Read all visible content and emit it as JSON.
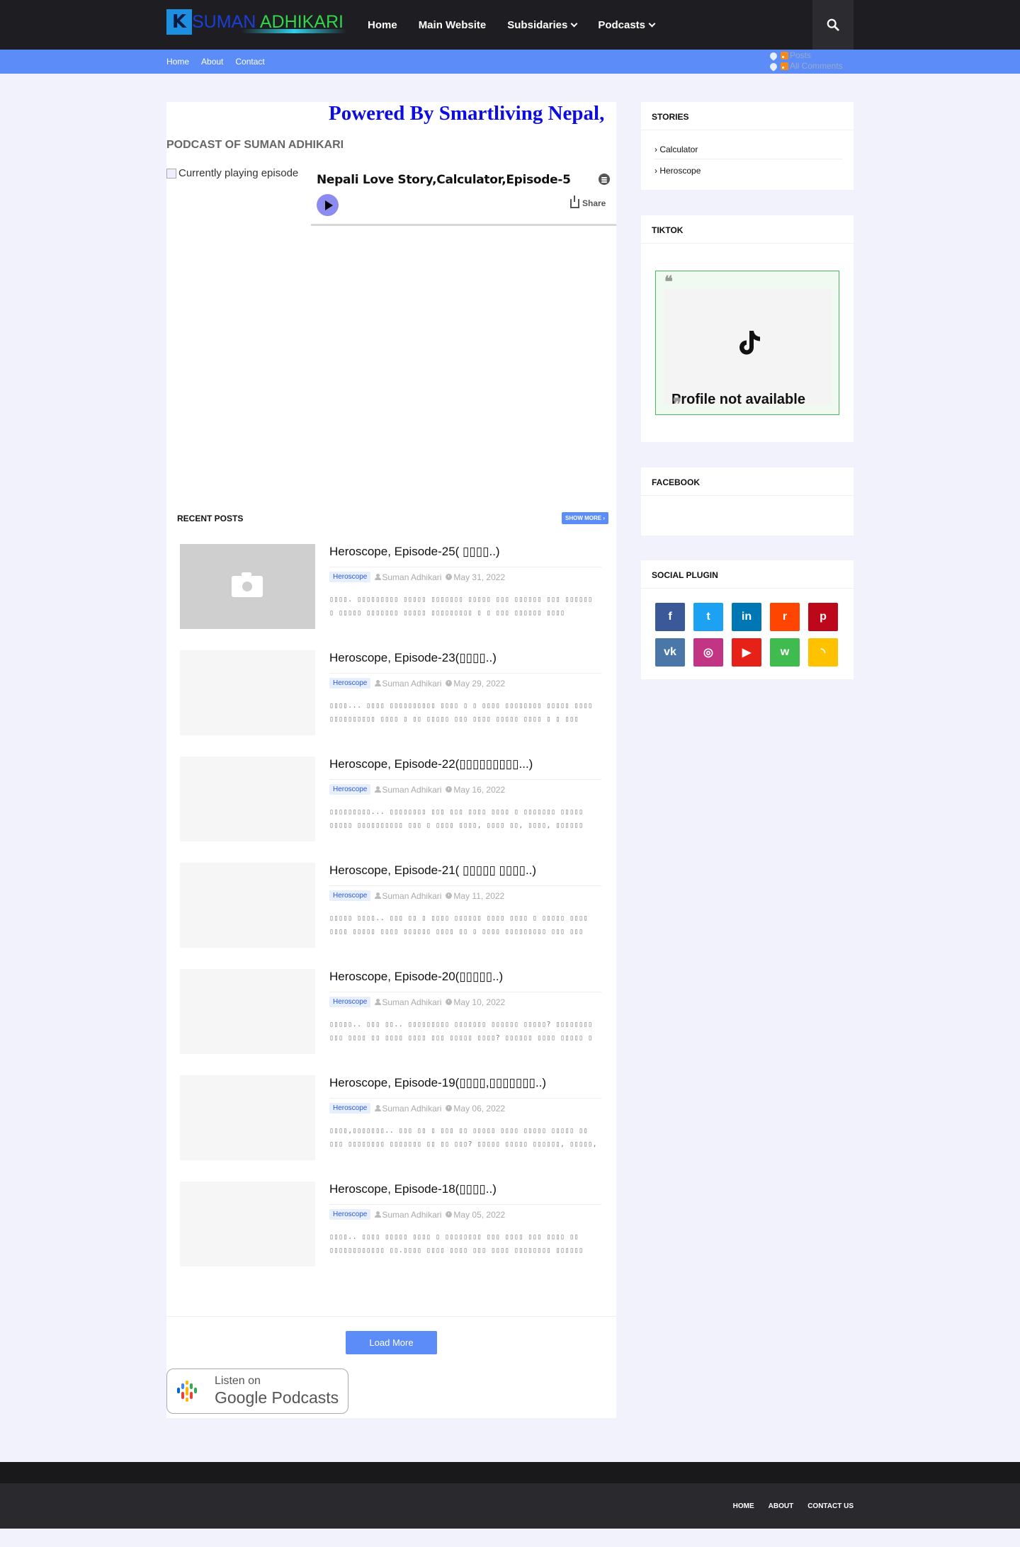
{
  "header": {
    "logo_part1": "SUMAN",
    "logo_part2": "ADHIKARI",
    "nav": [
      {
        "label": "Home"
      },
      {
        "label": "Main Website"
      },
      {
        "label": "Subsidaries",
        "has_dropdown": true
      },
      {
        "label": "Podcasts",
        "has_dropdown": true
      }
    ],
    "search_icon": "search-icon"
  },
  "subnav": {
    "links": [
      "Home",
      "About",
      "Contact"
    ],
    "feeds": [
      "Posts",
      "All Comments"
    ]
  },
  "main": {
    "powered_by": "Powered By Smartliving Nepal,",
    "podcast_heading": "PODCAST OF SUMAN ADHIKARI",
    "player": {
      "cover_alt": "Currently playing episode",
      "episode_title": "Nepali Love Story,Calculator,Episode-5",
      "share_label": "Share"
    },
    "recent_posts_label": "RECENT POSTS",
    "show_more_label": "SHOW MORE ›",
    "posts": [
      {
        "title": "Heroscope, Episode-25( ▯▯▯▯..)",
        "label": "Heroscope",
        "author": "Suman Adhikari",
        "date": "May 31, 2022",
        "snippet": "▯▯▯▯. ▯▯▯▯▯▯▯▯▯ ▯▯▯▯▯ ▯▯▯▯▯▯▯ ▯▯▯▯▯ ▯▯▯ ▯▯▯▯▯▯ ▯▯▯ ▯▯▯▯▯▯ ▯ ▯▯▯▯▯ ▯▯▯▯▯▯▯ ▯▯▯▯▯ ▯▯▯▯▯▯▯▯▯ ▯ ▯ ▯▯▯ ▯▯▯▯▯▯ ▯▯▯▯ ▯▯▯▯▯▯▯ ..."
      },
      {
        "title": "Heroscope, Episode-23(▯▯▯▯..)",
        "label": "Heroscope",
        "author": "Suman Adhikari",
        "date": "May 29, 2022",
        "snippet": "▯▯▯▯... ▯▯▯▯ ▯▯▯▯▯▯▯▯▯▯ ▯▯▯▯ ▯ ▯ ▯▯▯▯ ▯▯▯▯▯▯▯▯ ▯▯▯▯▯ ▯▯▯▯ ▯▯▯▯▯▯▯▯▯▯ ▯▯▯▯ ▯ ▯▯ ▯▯▯▯▯ ▯▯▯ ▯▯▯▯ ▯▯▯▯▯ ▯▯▯▯ ▯ ▯ ▯▯▯ ▯▯▯▯▯▯ ..."
      },
      {
        "title": "Heroscope, Episode-22(▯▯▯▯▯▯▯▯▯...)",
        "label": "Heroscope",
        "author": "Suman Adhikari",
        "date": "May 16, 2022",
        "snippet": "▯▯▯▯▯▯▯▯▯... ▯▯▯▯▯▯▯▯ ▯▯▯ ▯▯▯ ▯▯▯▯ ▯▯▯▯ ▯ ▯▯▯▯▯▯▯ ▯▯▯▯▯ ▯▯▯▯▯ ▯▯▯▯▯▯▯▯▯▯ ▯▯▯ ▯ ▯▯▯▯ ▯▯▯▯, ▯▯▯▯ ▯▯, ▯▯▯▯, ▯▯▯▯▯▯ ▯▯▯▯ ▯▯▯..."
      },
      {
        "title": "Heroscope, Episode-21( ▯▯▯▯▯ ▯▯▯▯..)",
        "label": "Heroscope",
        "author": "Suman Adhikari",
        "date": "May 11, 2022",
        "snippet": "▯▯▯▯▯ ▯▯▯▯.. ▯▯▯ ▯▯ ▯ ▯▯▯▯ ▯▯▯▯▯▯ ▯▯▯▯ ▯▯▯▯ ▯ ▯▯▯▯▯ ▯▯▯▯ ▯▯▯▯ ▯▯▯▯▯ ▯▯▯▯ ▯▯▯▯▯▯ ▯▯▯▯ ▯▯ ▯ ▯▯▯▯ ▯▯▯▯▯▯▯▯▯ ▯▯▯ ▯▯▯ ▯▯▯▯▯..."
      },
      {
        "title": "Heroscope, Episode-20(▯▯▯▯▯..)",
        "label": "Heroscope",
        "author": "Suman Adhikari",
        "date": "May 10, 2022",
        "snippet": "▯▯▯▯▯..  ▯▯▯ ▯▯.. ▯▯▯▯▯▯▯▯▯ ▯▯▯▯▯▯▯ ▯▯▯▯▯▯ ▯▯▯▯▯? ▯▯▯▯▯▯▯▯ ▯▯▯ ▯▯▯▯ ▯▯ ▯▯▯▯ ▯▯▯▯ ▯▯▯ ▯▯▯▯▯ ▯▯▯▯? ▯▯▯▯▯▯ ▯▯▯▯ ▯▯▯▯▯ ▯ ..."
      },
      {
        "title": "Heroscope, Episode-19(▯▯▯▯,▯▯▯▯▯▯▯..)",
        "label": "Heroscope",
        "author": "Suman Adhikari",
        "date": "May 06, 2022",
        "snippet": "▯▯▯▯,▯▯▯▯▯▯▯.. ▯▯▯ ▯▯ ▯ ▯▯▯ ▯▯ ▯▯▯▯▯ ▯▯▯▯ ▯▯▯▯▯ ▯▯▯▯▯ ▯▯ ▯▯▯ ▯▯▯▯▯▯▯▯ ▯▯▯▯▯▯▯ ▯▯ ▯▯ ▯▯▯? ▯▯▯▯▯ ▯▯▯▯▯ ▯▯▯▯▯▯, ▯▯▯▯▯,  ▯▯▯..."
      },
      {
        "title": "Heroscope, Episode-18(▯▯▯▯..)",
        "label": "Heroscope",
        "author": "Suman Adhikari",
        "date": "May 05, 2022",
        "snippet": "▯▯▯▯.. ▯▯▯▯ ▯▯▯▯▯ ▯▯▯▯ ▯ ▯▯▯▯▯▯▯▯ ▯▯▯ ▯▯▯▯ ▯▯▯ ▯▯▯▯ ▯▯ ▯▯▯▯▯▯▯▯▯▯▯▯ ▯▯.▯▯▯▯ ▯▯▯▯ ▯▯▯▯ ▯▯▯ ▯▯▯▯ ▯▯▯▯▯▯▯▯ ▯▯▯▯▯▯ ▯▯▯▯ ▯ ▯▯ ..."
      }
    ],
    "load_more_label": "Load More",
    "google_podcasts": {
      "listen_on": "Listen on",
      "brand": "Google Podcasts"
    }
  },
  "sidebar": {
    "stories": {
      "title": "STORIES",
      "items": [
        "› Calculator",
        "› Heroscope"
      ]
    },
    "tiktok": {
      "title": "TIKTOK",
      "message": "Profile not available"
    },
    "facebook": {
      "title": "FACEBOOK"
    },
    "social": {
      "title": "SOCIAL PLUGIN",
      "icons": [
        {
          "name": "facebook-icon",
          "color": "#3b5998",
          "glyph": "f"
        },
        {
          "name": "twitter-icon",
          "color": "#1da1f2",
          "glyph": "t"
        },
        {
          "name": "linkedin-icon",
          "color": "#0077b5",
          "glyph": "in"
        },
        {
          "name": "reddit-icon",
          "color": "#ff4500",
          "glyph": "r"
        },
        {
          "name": "pinterest-icon",
          "color": "#bd081c",
          "glyph": "p"
        },
        {
          "name": "vk-icon",
          "color": "#4a76a8",
          "glyph": "vk"
        },
        {
          "name": "instagram-icon",
          "color": "#c13584",
          "glyph": "◎"
        },
        {
          "name": "youtube-icon",
          "color": "#e62117",
          "glyph": "▶"
        },
        {
          "name": "whatsapp-icon",
          "color": "#3fbb50",
          "glyph": "w"
        },
        {
          "name": "rss-icon",
          "color": "#ffc200",
          "glyph": "◝"
        }
      ]
    }
  },
  "footer": {
    "links": [
      "HOME",
      "ABOUT",
      "CONTACT US"
    ]
  }
}
